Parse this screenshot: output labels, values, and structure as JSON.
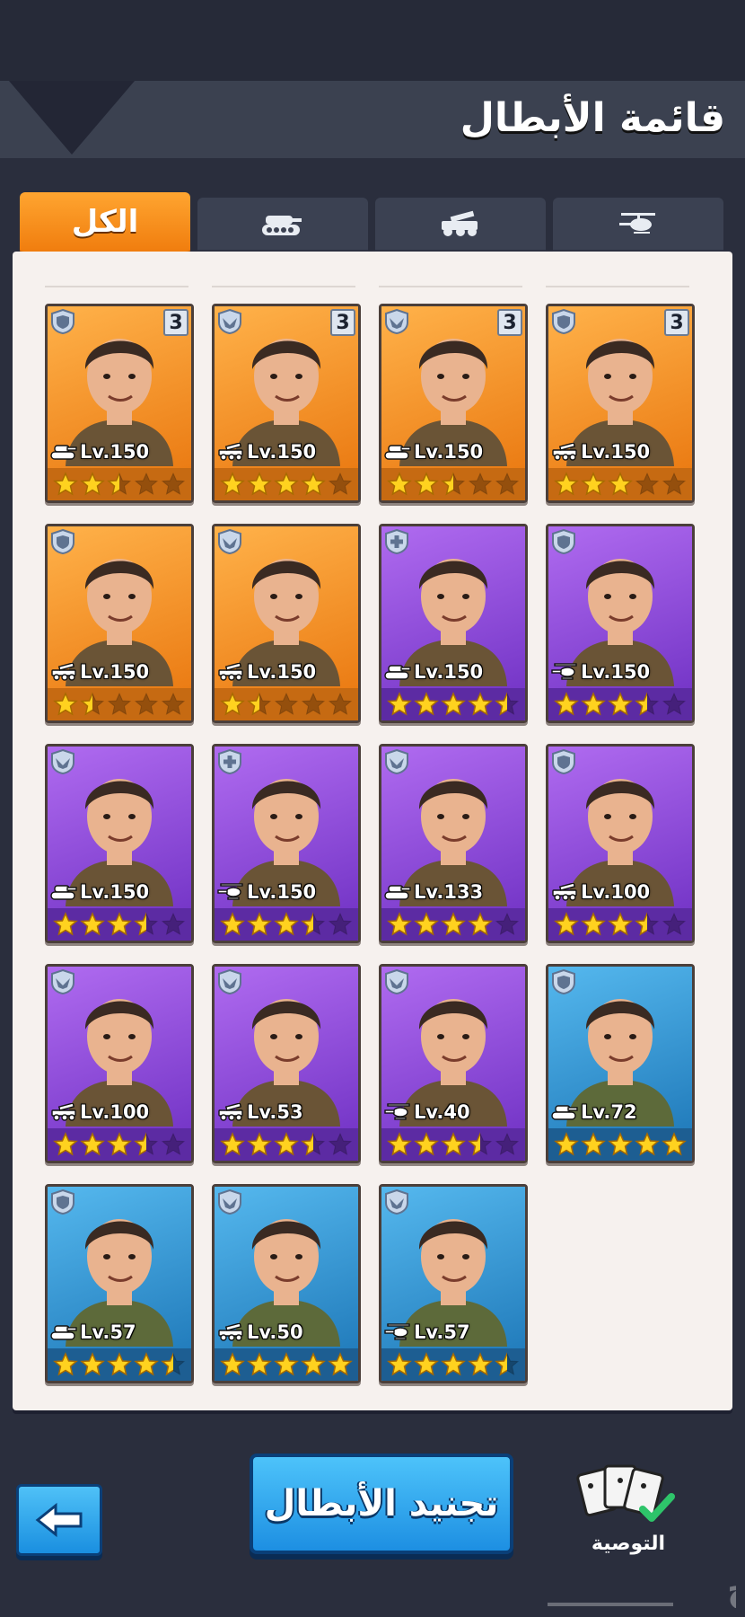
{
  "header": {
    "title": "قائمة الأبطال"
  },
  "tabs": [
    {
      "label": "الكل",
      "active": true
    },
    {
      "icon": "tank-icon",
      "active": false
    },
    {
      "icon": "artillery-truck-icon",
      "active": false
    },
    {
      "icon": "helicopter-icon",
      "active": false
    }
  ],
  "colors": {
    "accent": "#f07d0e",
    "button_blue": "#1d8fe0",
    "rarity_orange": "#e8740c",
    "rarity_purple": "#6d2fc2",
    "rarity_blue": "#1b74b5",
    "star": "#ffd21f"
  },
  "heroes": [
    {
      "rarity": "orange",
      "class_icon": "shield-icon",
      "count": "3",
      "type_icon": "tank-icon",
      "level": "Lv.150",
      "stars": 2.5
    },
    {
      "rarity": "orange",
      "class_icon": "wings-icon",
      "count": "3",
      "type_icon": "artillery-truck-icon",
      "level": "Lv.150",
      "stars": 4
    },
    {
      "rarity": "orange",
      "class_icon": "wings-icon",
      "count": "3",
      "type_icon": "tank-icon",
      "level": "Lv.150",
      "stars": 2.5
    },
    {
      "rarity": "orange",
      "class_icon": "shield-icon",
      "count": "3",
      "type_icon": "artillery-truck-icon",
      "level": "Lv.150",
      "stars": 3
    },
    {
      "rarity": "orange",
      "class_icon": "shield-icon",
      "count": "",
      "type_icon": "artillery-truck-icon",
      "level": "Lv.150",
      "stars": 1.5
    },
    {
      "rarity": "orange",
      "class_icon": "wings-icon",
      "count": "",
      "type_icon": "artillery-truck-icon",
      "level": "Lv.150",
      "stars": 1.5
    },
    {
      "rarity": "purple",
      "class_icon": "medic-cross-icon",
      "count": "",
      "type_icon": "tank-icon",
      "level": "Lv.150",
      "stars": 4.5
    },
    {
      "rarity": "purple",
      "class_icon": "shield-icon",
      "count": "",
      "type_icon": "helicopter-icon",
      "level": "Lv.150",
      "stars": 3.5
    },
    {
      "rarity": "purple",
      "class_icon": "wings-icon",
      "count": "",
      "type_icon": "tank-icon",
      "level": "Lv.150",
      "stars": 3.5
    },
    {
      "rarity": "purple",
      "class_icon": "medic-cross-icon",
      "count": "",
      "type_icon": "helicopter-icon",
      "level": "Lv.150",
      "stars": 3.5
    },
    {
      "rarity": "purple",
      "class_icon": "wings-icon",
      "count": "",
      "type_icon": "tank-icon",
      "level": "Lv.133",
      "stars": 4
    },
    {
      "rarity": "purple",
      "class_icon": "shield-icon",
      "count": "",
      "type_icon": "artillery-truck-icon",
      "level": "Lv.100",
      "stars": 3.5
    },
    {
      "rarity": "purple",
      "class_icon": "wings-icon",
      "count": "",
      "type_icon": "artillery-truck-icon",
      "level": "Lv.100",
      "stars": 3.5
    },
    {
      "rarity": "purple",
      "class_icon": "wings-icon",
      "count": "",
      "type_icon": "artillery-truck-icon",
      "level": "Lv.53",
      "stars": 3.5
    },
    {
      "rarity": "purple",
      "class_icon": "wings-icon",
      "count": "",
      "type_icon": "helicopter-icon",
      "level": "Lv.40",
      "stars": 3.5
    },
    {
      "rarity": "blue",
      "class_icon": "shield-icon",
      "count": "",
      "type_icon": "tank-icon",
      "level": "Lv.72",
      "stars": 5
    },
    {
      "rarity": "blue",
      "class_icon": "shield-icon",
      "count": "",
      "type_icon": "tank-icon",
      "level": "Lv.57",
      "stars": 4.5
    },
    {
      "rarity": "blue",
      "class_icon": "wings-icon",
      "count": "",
      "type_icon": "artillery-truck-icon",
      "level": "Lv.50",
      "stars": 5
    },
    {
      "rarity": "blue",
      "class_icon": "wings-icon",
      "count": "",
      "type_icon": "helicopter-icon",
      "level": "Lv.57",
      "stars": 4.5
    }
  ],
  "footer": {
    "back_icon": "arrow-left-icon",
    "recruit_label": "تجنيد الأبطال",
    "recommend_label": "التوصية"
  },
  "watermark": "حراج"
}
